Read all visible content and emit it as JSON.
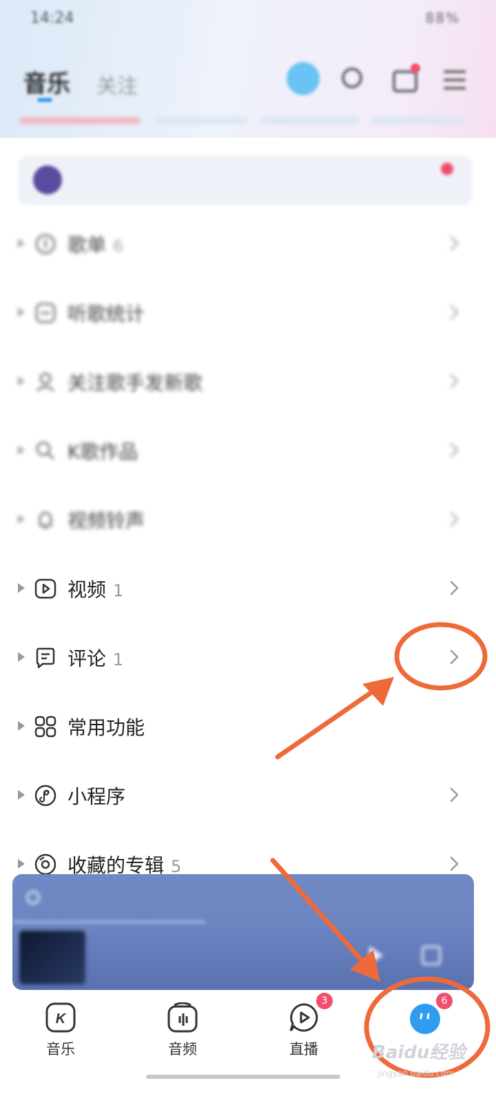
{
  "status_bar": {
    "time": "14:24",
    "right": "88%"
  },
  "header": {
    "tab_music": "音乐",
    "tab_follow": "关注"
  },
  "profile": {
    "name": "",
    "tag": ""
  },
  "sections": [
    {
      "label": "歌单",
      "count": "6",
      "sub": "",
      "blurred": true,
      "icon": "playlist-icon",
      "chevron": true
    },
    {
      "label": "听歌统计",
      "count": "",
      "sub": "",
      "blurred": true,
      "icon": "stats-icon",
      "chevron": true
    },
    {
      "label": "关注歌手发新歌",
      "count": "",
      "sub": "",
      "blurred": true,
      "icon": "singer-icon",
      "chevron": true
    },
    {
      "label": "K歌作品",
      "count": "",
      "sub": "",
      "blurred": true,
      "icon": "karaoke-icon",
      "chevron": true
    },
    {
      "label": "视频铃声",
      "count": "",
      "sub": "",
      "blurred": true,
      "icon": "ringtone-icon",
      "chevron": true
    },
    {
      "label": "视频",
      "count": "1",
      "sub": "",
      "blurred": false,
      "icon": "video-icon",
      "chevron": true
    },
    {
      "label": "评论",
      "count": "1",
      "sub": "",
      "blurred": false,
      "icon": "comment-icon",
      "chevron": true
    },
    {
      "label": "常用功能",
      "count": "",
      "sub": "",
      "blurred": false,
      "icon": "grid-icon",
      "chevron": false
    },
    {
      "label": "小程序",
      "count": "",
      "sub": "",
      "blurred": false,
      "icon": "miniprogram-icon",
      "chevron": true
    },
    {
      "label": "收藏的专辑",
      "count": "5",
      "sub": "",
      "blurred": false,
      "icon": "album-icon",
      "chevron": true
    }
  ],
  "player": {
    "message": "",
    "action": "",
    "title": "",
    "artist": ""
  },
  "bottom_nav": [
    {
      "label": "音乐",
      "icon": "music-k-icon",
      "badge": ""
    },
    {
      "label": "音频",
      "icon": "audio-icon",
      "badge": ""
    },
    {
      "label": "直播",
      "icon": "live-icon",
      "badge": "3"
    },
    {
      "label": "",
      "icon": "me-avatar-icon",
      "badge": "6"
    }
  ],
  "watermark": {
    "brand": "Baidu经验",
    "url": "jingyan.baidu.com"
  },
  "colors": {
    "accent": "#3aa0f0",
    "badge": "#f0506e",
    "annotation": "#ef6a3a",
    "player_bg": "#6d86c2"
  }
}
